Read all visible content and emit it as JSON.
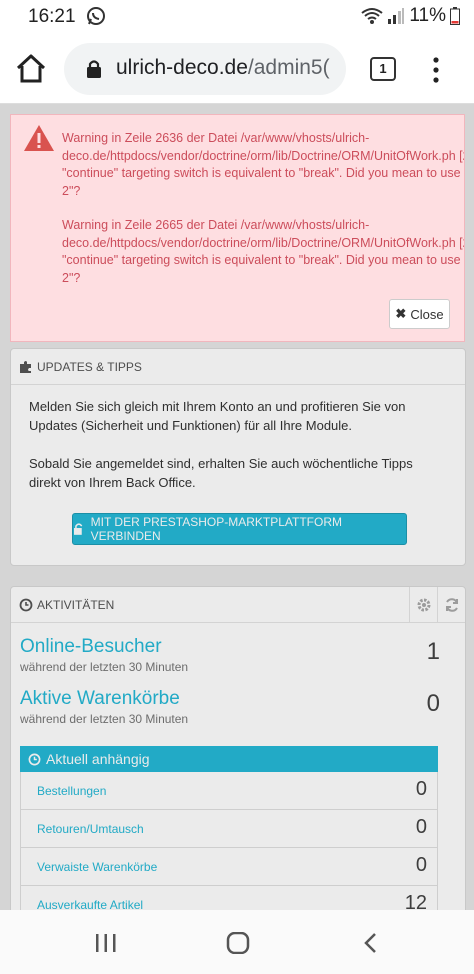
{
  "status_bar": {
    "time": "16:21",
    "battery_pct": "11%",
    "icons": [
      "whatsapp-icon",
      "wifi-icon",
      "signal-icon",
      "battery-icon"
    ]
  },
  "browser": {
    "url_host": "ulrich-deco.de",
    "url_path": "/admin5(",
    "tab_count": "1"
  },
  "warning": {
    "messages": [
      "Warning in Zeile 2636 der Datei /var/www/vhosts/ulrich-deco.de/httpdocs/vendor/doctrine/orm/lib/Doctrine/ORM/UnitOfWork.ph [2] \"continue\" targeting switch is equivalent to \"break\". Did you mean to use \"continue 2\"?",
      "Warning in Zeile 2665 der Datei /var/www/vhosts/ulrich-deco.de/httpdocs/vendor/doctrine/orm/lib/Doctrine/ORM/UnitOfWork.ph [2] \"continue\" targeting switch is equivalent to \"break\". Did you mean to use \"continue 2\"?"
    ],
    "close_label": "Close"
  },
  "updates": {
    "title": "UPDATES & TIPPS",
    "paragraph1": "Melden Sie sich gleich mit Ihrem Konto an und profitieren Sie von Updates (Sicherheit und Funktionen) für all Ihre Module.",
    "paragraph2": "Sobald Sie angemeldet sind, erhalten Sie auch wöchentliche Tipps direkt von Ihrem Back Office.",
    "connect_label": "MIT DER PRESTASHOP-MARKTPLATTFORM VERBINDEN"
  },
  "activities": {
    "title": "AKTIVITÄTEN",
    "online": {
      "label": "Online-Besucher",
      "sub": "während der letzten 30 Minuten",
      "value": "1"
    },
    "carts": {
      "label": "Aktive Warenkörbe",
      "sub": "während der letzten 30 Minuten",
      "value": "0"
    },
    "pending_title": "Aktuell anhängig",
    "pending_rows": [
      {
        "label": "Bestellungen",
        "value": "0"
      },
      {
        "label": "Retouren/Umtausch",
        "value": "0"
      },
      {
        "label": "Verwaiste Warenkörbe",
        "value": "0"
      },
      {
        "label": "Ausverkaufte Artikel",
        "value": "12"
      }
    ]
  },
  "colors": {
    "accent": "#25b9d7",
    "warning_bg": "#fedee1",
    "warning_text": "#cc4d5b"
  }
}
